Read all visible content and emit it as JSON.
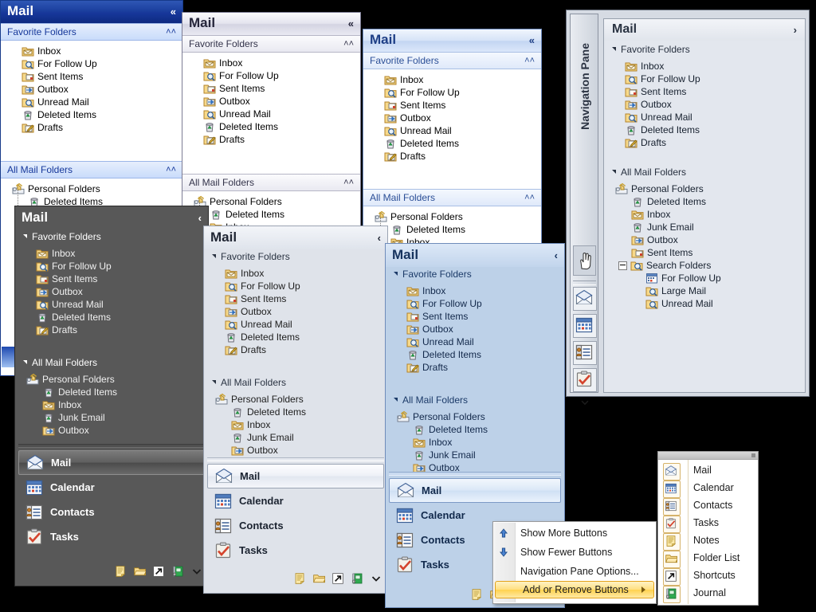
{
  "app": {
    "title": "Mail",
    "favorite_folders_label": "Favorite Folders",
    "all_mail_folders_label": "All Mail Folders",
    "navigation_pane_label": "Navigation Pane"
  },
  "favorites": [
    {
      "label": "Inbox",
      "icon": "inbox-folder-icon"
    },
    {
      "label": "For Follow Up",
      "icon": "search-folder-icon"
    },
    {
      "label": "Sent Items",
      "icon": "sent-folder-icon"
    },
    {
      "label": "Outbox",
      "icon": "outbox-folder-icon"
    },
    {
      "label": "Unread Mail",
      "icon": "search-folder-icon"
    },
    {
      "label": "Deleted Items",
      "icon": "trash-icon"
    },
    {
      "label": "Drafts",
      "icon": "drafts-folder-icon"
    }
  ],
  "tree_short": [
    {
      "label": "Personal Folders",
      "icon": "personal-folders-icon",
      "level": 1
    },
    {
      "label": "Deleted Items",
      "icon": "trash-icon",
      "level": 2
    },
    {
      "label": "Inbox",
      "icon": "inbox-folder-icon",
      "level": 2
    }
  ],
  "tree_medium": [
    {
      "label": "Personal Folders",
      "icon": "personal-folders-icon",
      "level": 1
    },
    {
      "label": "Deleted Items",
      "icon": "trash-icon",
      "level": 2
    },
    {
      "label": "Inbox",
      "icon": "inbox-folder-icon",
      "level": 2
    },
    {
      "label": "Junk Email",
      "icon": "trash-icon",
      "level": 2
    },
    {
      "label": "Outbox",
      "icon": "outbox-folder-icon",
      "level": 2
    }
  ],
  "tree_full": [
    {
      "label": "Personal Folders",
      "icon": "personal-folders-icon",
      "level": 1
    },
    {
      "label": "Deleted Items",
      "icon": "trash-icon",
      "level": 2
    },
    {
      "label": "Inbox",
      "icon": "inbox-folder-icon",
      "level": 2
    },
    {
      "label": "Junk Email",
      "icon": "trash-icon",
      "level": 2
    },
    {
      "label": "Outbox",
      "icon": "outbox-folder-icon",
      "level": 2
    },
    {
      "label": "Sent Items",
      "icon": "sent-folder-icon",
      "level": 2
    },
    {
      "label": "Search Folders",
      "icon": "search-folder-icon",
      "level": 2
    },
    {
      "label": "For Follow Up",
      "icon": "calendar-small-icon",
      "level": 3
    },
    {
      "label": "Large Mail",
      "icon": "search-folder-icon",
      "level": 3
    },
    {
      "label": "Unread Mail",
      "icon": "search-folder-icon",
      "level": 3
    }
  ],
  "nav_buttons": [
    {
      "label": "Mail",
      "icon": "mail-icon",
      "selected": true
    },
    {
      "label": "Calendar",
      "icon": "calendar-icon",
      "selected": false
    },
    {
      "label": "Contacts",
      "icon": "contacts-icon",
      "selected": false
    },
    {
      "label": "Tasks",
      "icon": "tasks-icon",
      "selected": false
    }
  ],
  "small_buttons": [
    {
      "icon": "notes-icon",
      "name": "notes"
    },
    {
      "icon": "folderlist-icon",
      "name": "folder-list"
    },
    {
      "icon": "shortcuts-icon",
      "name": "shortcuts"
    },
    {
      "icon": "journal-icon",
      "name": "journal"
    },
    {
      "icon": "chevron-down-icon",
      "name": "configure"
    }
  ],
  "vertical_buttons": [
    {
      "icon": "mail-icon",
      "name": "mail"
    },
    {
      "icon": "calendar-icon",
      "name": "calendar"
    },
    {
      "icon": "contacts-icon",
      "name": "contacts"
    },
    {
      "icon": "tasks-icon",
      "name": "tasks"
    },
    {
      "icon": "chevron-down-icon",
      "name": "configure"
    }
  ],
  "context_menu": {
    "items": [
      {
        "label": "Show More Buttons",
        "icon": "arrow-up-icon",
        "highlighted": false,
        "submenu": false
      },
      {
        "label": "Show Fewer Buttons",
        "icon": "arrow-down-icon",
        "highlighted": false,
        "submenu": false
      },
      {
        "label": "Navigation Pane Options...",
        "icon": "",
        "highlighted": false,
        "submenu": false
      },
      {
        "label": "Add or Remove Buttons",
        "icon": "",
        "highlighted": true,
        "submenu": true
      }
    ]
  },
  "submenu": {
    "items": [
      {
        "label": "Mail",
        "icon": "mail-icon"
      },
      {
        "label": "Calendar",
        "icon": "calendar-icon"
      },
      {
        "label": "Contacts",
        "icon": "contacts-icon"
      },
      {
        "label": "Tasks",
        "icon": "tasks-icon"
      },
      {
        "label": "Notes",
        "icon": "notes-icon"
      },
      {
        "label": "Folder List",
        "icon": "folderlist-icon"
      },
      {
        "label": "Shortcuts",
        "icon": "shortcuts-icon"
      },
      {
        "label": "Journal",
        "icon": "journal-icon"
      }
    ]
  },
  "collapse_glyphs": {
    "double_left": "«",
    "single_left": "‹",
    "single_right": "›",
    "group_collapse": "˄˄"
  },
  "colors": {
    "blue_header": "#17379a",
    "dark_pane": "#585858",
    "grey_pane": "#dfe3ea",
    "blue_pane": "#bdd1e8",
    "highlight_yellow": "#ffd24f",
    "selection_blue": "#2f5fc0"
  }
}
